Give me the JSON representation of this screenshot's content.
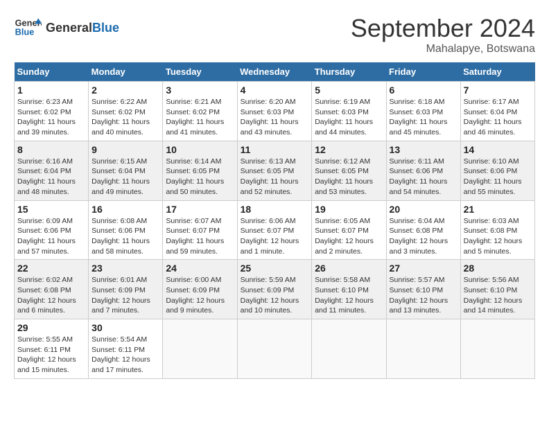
{
  "header": {
    "logo_text_general": "General",
    "logo_text_blue": "Blue",
    "month": "September 2024",
    "location": "Mahalapye, Botswana"
  },
  "days_of_week": [
    "Sunday",
    "Monday",
    "Tuesday",
    "Wednesday",
    "Thursday",
    "Friday",
    "Saturday"
  ],
  "weeks": [
    [
      {
        "day": "1",
        "sunrise": "6:23 AM",
        "sunset": "6:02 PM",
        "daylight": "11 hours and 39 minutes."
      },
      {
        "day": "2",
        "sunrise": "6:22 AM",
        "sunset": "6:02 PM",
        "daylight": "11 hours and 40 minutes."
      },
      {
        "day": "3",
        "sunrise": "6:21 AM",
        "sunset": "6:02 PM",
        "daylight": "11 hours and 41 minutes."
      },
      {
        "day": "4",
        "sunrise": "6:20 AM",
        "sunset": "6:03 PM",
        "daylight": "11 hours and 43 minutes."
      },
      {
        "day": "5",
        "sunrise": "6:19 AM",
        "sunset": "6:03 PM",
        "daylight": "11 hours and 44 minutes."
      },
      {
        "day": "6",
        "sunrise": "6:18 AM",
        "sunset": "6:03 PM",
        "daylight": "11 hours and 45 minutes."
      },
      {
        "day": "7",
        "sunrise": "6:17 AM",
        "sunset": "6:04 PM",
        "daylight": "11 hours and 46 minutes."
      }
    ],
    [
      {
        "day": "8",
        "sunrise": "6:16 AM",
        "sunset": "6:04 PM",
        "daylight": "11 hours and 48 minutes."
      },
      {
        "day": "9",
        "sunrise": "6:15 AM",
        "sunset": "6:04 PM",
        "daylight": "11 hours and 49 minutes."
      },
      {
        "day": "10",
        "sunrise": "6:14 AM",
        "sunset": "6:05 PM",
        "daylight": "11 hours and 50 minutes."
      },
      {
        "day": "11",
        "sunrise": "6:13 AM",
        "sunset": "6:05 PM",
        "daylight": "11 hours and 52 minutes."
      },
      {
        "day": "12",
        "sunrise": "6:12 AM",
        "sunset": "6:05 PM",
        "daylight": "11 hours and 53 minutes."
      },
      {
        "day": "13",
        "sunrise": "6:11 AM",
        "sunset": "6:06 PM",
        "daylight": "11 hours and 54 minutes."
      },
      {
        "day": "14",
        "sunrise": "6:10 AM",
        "sunset": "6:06 PM",
        "daylight": "11 hours and 55 minutes."
      }
    ],
    [
      {
        "day": "15",
        "sunrise": "6:09 AM",
        "sunset": "6:06 PM",
        "daylight": "11 hours and 57 minutes."
      },
      {
        "day": "16",
        "sunrise": "6:08 AM",
        "sunset": "6:06 PM",
        "daylight": "11 hours and 58 minutes."
      },
      {
        "day": "17",
        "sunrise": "6:07 AM",
        "sunset": "6:07 PM",
        "daylight": "11 hours and 59 minutes."
      },
      {
        "day": "18",
        "sunrise": "6:06 AM",
        "sunset": "6:07 PM",
        "daylight": "12 hours and 1 minute."
      },
      {
        "day": "19",
        "sunrise": "6:05 AM",
        "sunset": "6:07 PM",
        "daylight": "12 hours and 2 minutes."
      },
      {
        "day": "20",
        "sunrise": "6:04 AM",
        "sunset": "6:08 PM",
        "daylight": "12 hours and 3 minutes."
      },
      {
        "day": "21",
        "sunrise": "6:03 AM",
        "sunset": "6:08 PM",
        "daylight": "12 hours and 5 minutes."
      }
    ],
    [
      {
        "day": "22",
        "sunrise": "6:02 AM",
        "sunset": "6:08 PM",
        "daylight": "12 hours and 6 minutes."
      },
      {
        "day": "23",
        "sunrise": "6:01 AM",
        "sunset": "6:09 PM",
        "daylight": "12 hours and 7 minutes."
      },
      {
        "day": "24",
        "sunrise": "6:00 AM",
        "sunset": "6:09 PM",
        "daylight": "12 hours and 9 minutes."
      },
      {
        "day": "25",
        "sunrise": "5:59 AM",
        "sunset": "6:09 PM",
        "daylight": "12 hours and 10 minutes."
      },
      {
        "day": "26",
        "sunrise": "5:58 AM",
        "sunset": "6:10 PM",
        "daylight": "12 hours and 11 minutes."
      },
      {
        "day": "27",
        "sunrise": "5:57 AM",
        "sunset": "6:10 PM",
        "daylight": "12 hours and 13 minutes."
      },
      {
        "day": "28",
        "sunrise": "5:56 AM",
        "sunset": "6:10 PM",
        "daylight": "12 hours and 14 minutes."
      }
    ],
    [
      {
        "day": "29",
        "sunrise": "5:55 AM",
        "sunset": "6:11 PM",
        "daylight": "12 hours and 15 minutes."
      },
      {
        "day": "30",
        "sunrise": "5:54 AM",
        "sunset": "6:11 PM",
        "daylight": "12 hours and 17 minutes."
      },
      null,
      null,
      null,
      null,
      null
    ]
  ],
  "labels": {
    "sunrise": "Sunrise:",
    "sunset": "Sunset:",
    "daylight": "Daylight:"
  }
}
